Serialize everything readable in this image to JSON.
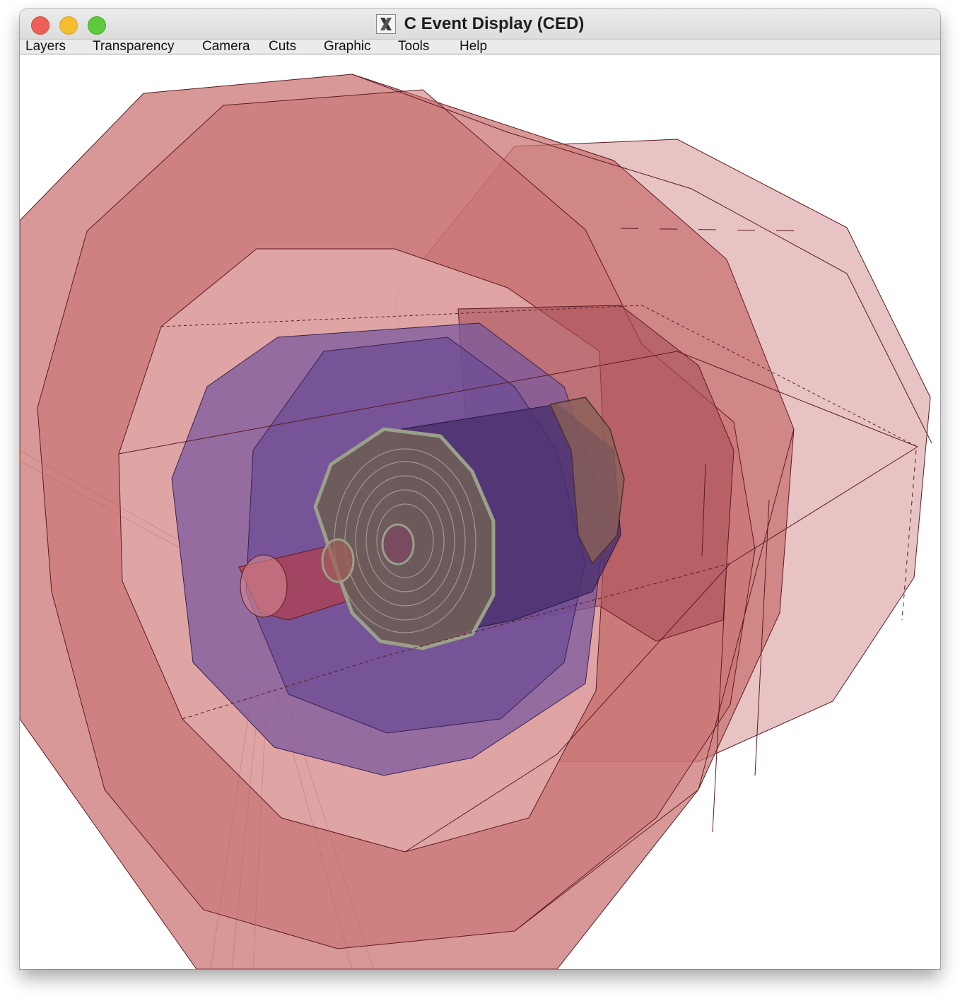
{
  "window": {
    "title": "C Event Display (CED)",
    "title_icon": "x11-icon",
    "controls": [
      "close",
      "minimize",
      "zoom"
    ]
  },
  "menubar": {
    "items": [
      {
        "id": "layers",
        "label": "Layers"
      },
      {
        "id": "transparency",
        "label": "Transparency"
      },
      {
        "id": "camera",
        "label": "Camera"
      },
      {
        "id": "cuts",
        "label": "Cuts"
      },
      {
        "id": "graphic",
        "label": "Graphic"
      },
      {
        "id": "tools",
        "label": "Tools"
      },
      {
        "id": "help",
        "label": "Help"
      }
    ]
  },
  "scene": {
    "description_colors": {
      "outer_detector": "#c8706f",
      "calorimeter": "#7b5a9e",
      "tracker": "#6e5c58",
      "edges": "#5a1a22",
      "background": "#ffffff"
    }
  }
}
